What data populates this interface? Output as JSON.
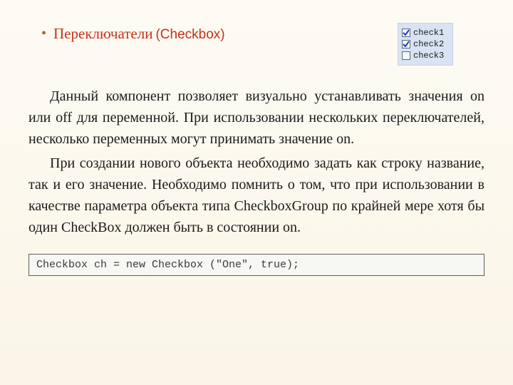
{
  "heading": {
    "bullet": "•",
    "main": "Переключатели",
    "paren": "(Checkbox)"
  },
  "sample": {
    "items": [
      {
        "label": "check1",
        "checked": true
      },
      {
        "label": "check2",
        "checked": true
      },
      {
        "label": "check3",
        "checked": false
      }
    ]
  },
  "paragraphs": {
    "p1": "Данный компонент позволяет визуально устанавливать значения on или off для переменной. При использовании нескольких переключателей, несколько переменных могут принимать значение on.",
    "p2": "При создании нового объекта необходимо задать как строку название, так и его значение. Необходимо помнить о том, что при использовании в качестве параметра объекта типа CheckboxGroup по крайней мере хотя бы один CheckBox должен быть в состоянии on."
  },
  "code": "Checkbox ch = new Checkbox (\"One\", true);"
}
